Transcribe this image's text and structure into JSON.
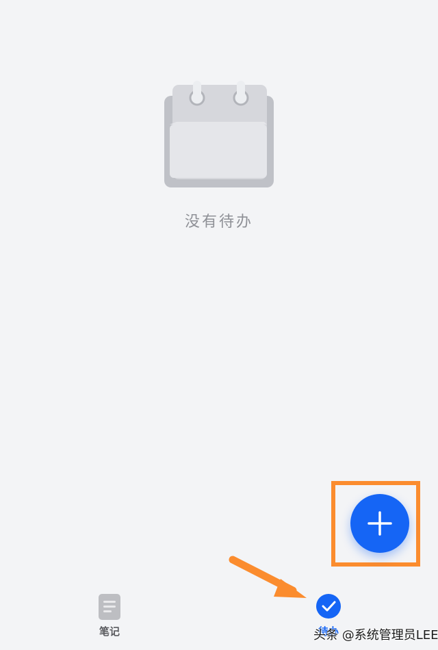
{
  "empty_state": {
    "icon": "calendar-icon",
    "message": "没有待办"
  },
  "fab": {
    "icon": "plus-icon"
  },
  "bottom_nav": {
    "tabs": [
      {
        "label": "笔记",
        "icon": "note-icon",
        "active": false
      },
      {
        "label": "待办",
        "icon": "check-circle-icon",
        "active": true
      }
    ]
  },
  "annotations": {
    "highlight_color": "#fb8c2e",
    "arrow_color": "#fb8c2e"
  },
  "watermark": {
    "text": "头条 @系统管理员LEE"
  },
  "colors": {
    "background": "#f3f4f6",
    "accent": "#1565f5",
    "muted_text": "#8e9096"
  }
}
